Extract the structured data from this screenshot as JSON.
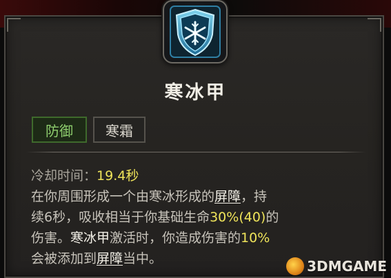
{
  "skill": {
    "name": "寒冰甲",
    "icon": "frost-shield-snowflake-icon"
  },
  "tags": [
    "防御",
    "寒霜"
  ],
  "description": {
    "cooldown_label": "冷却时间：",
    "cooldown_value": "19.4秒",
    "line1_a": "在你周围形成一个由寒冰形成的",
    "line1_link": "屏障",
    "line1_b": "，持",
    "line2_a": "续6秒，吸收相当于你基础生命",
    "line2_value": "30%(40)",
    "line2_b": "的",
    "line3_a": "伤害。",
    "line3_skill": "寒冰甲",
    "line3_b": "激活时，你造成伤害的",
    "line3_value": "10%",
    "line4_a": "会被添加到",
    "line4_link": "屏障",
    "line4_b": "当中。"
  },
  "watermark": {
    "text": "3DMGAME"
  },
  "colors": {
    "accent_yellow": "#efe45a",
    "tag_green": "#8fcf6e",
    "panel": "#262421"
  }
}
